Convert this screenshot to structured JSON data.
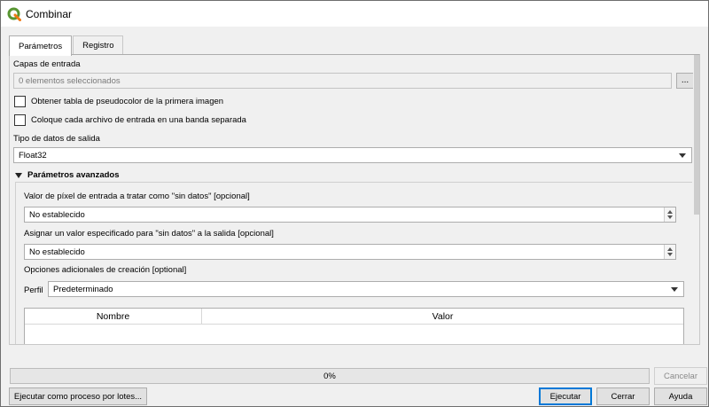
{
  "window": {
    "title": "Combinar",
    "logo_icon": "qgis-logo-icon"
  },
  "tabs": [
    {
      "label": "Parámetros",
      "active": true
    },
    {
      "label": "Registro",
      "active": false
    }
  ],
  "params": {
    "input_layers_label": "Capas de entrada",
    "input_layers_value": "0 elementos seleccionados",
    "browse_label": "...",
    "pct_checkbox_label": "Obtener tabla de pseudocolor de la primera imagen",
    "pct_checked": false,
    "separate_checkbox_label": "Coloque cada archivo de entrada en una banda separada",
    "separate_checked": false,
    "output_type_label": "Tipo de datos de salida",
    "output_type_value": "Float32"
  },
  "advanced": {
    "header": "Parámetros avanzados",
    "expanded": true,
    "nodata_input_label": "Valor de píxel de entrada a tratar como \"sin datos\" [opcional]",
    "nodata_input_value": "No establecido",
    "nodata_output_label": "Asignar un valor especificado para \"sin datos\" a la salida [opcional]",
    "nodata_output_value": "No establecido",
    "creation_options_label": "Opciones adicionales de creación [optional]",
    "profile_label": "Perfil",
    "profile_value": "Predeterminado",
    "table_columns": [
      "Nombre",
      "Valor"
    ]
  },
  "footer": {
    "progress_text": "0%",
    "progress_value": 0,
    "cancel_label": "Cancelar",
    "batch_label": "Ejecutar como proceso por lotes...",
    "run_label": "Ejecutar",
    "close_label": "Cerrar",
    "help_label": "Ayuda"
  },
  "colors": {
    "accent": "#0078d7",
    "qgis_green": "#589632",
    "qgis_yellow": "#ee7913"
  }
}
